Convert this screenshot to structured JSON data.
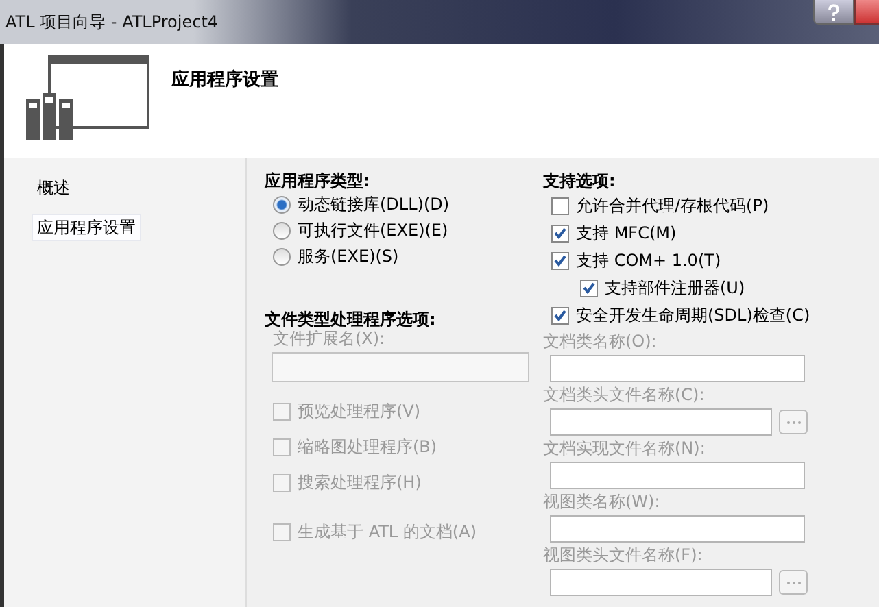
{
  "window": {
    "title": "ATL 项目向导 - ATLProject4"
  },
  "header": {
    "title": "应用程序设置"
  },
  "sidebar": {
    "items": [
      {
        "label": "概述",
        "selected": false
      },
      {
        "label": "应用程序设置",
        "selected": true
      }
    ]
  },
  "app_type": {
    "heading": "应用程序类型:",
    "options": [
      {
        "label": "动态链接库(DLL)(D)",
        "selected": true
      },
      {
        "label": "可执行文件(EXE)(E)",
        "selected": false
      },
      {
        "label": "服务(EXE)(S)",
        "selected": false
      }
    ]
  },
  "file_handlers": {
    "heading": "文件类型处理程序选项:",
    "extension_label": "文件扩展名(X):",
    "extension_disabled": true,
    "options": [
      {
        "label": "预览处理程序(V)",
        "checked": false,
        "disabled": true
      },
      {
        "label": "缩略图处理程序(B)",
        "checked": false,
        "disabled": true
      },
      {
        "label": "搜索处理程序(H)",
        "checked": false,
        "disabled": true
      },
      {
        "label": "生成基于 ATL 的文档(A)",
        "checked": false,
        "disabled": true
      }
    ]
  },
  "support": {
    "heading": "支持选项:",
    "options": [
      {
        "label": "允许合并代理/存根代码(P)",
        "checked": false,
        "disabled": false
      },
      {
        "label": "支持 MFC(M)",
        "checked": true,
        "disabled": false
      },
      {
        "label": "支持 COM+ 1.0(T)",
        "checked": true,
        "disabled": false,
        "children": [
          {
            "label": "支持部件注册器(U)",
            "checked": true,
            "disabled": false
          }
        ]
      },
      {
        "label": "安全开发生命周期(SDL)检查(C)",
        "checked": true,
        "disabled": false
      }
    ]
  },
  "doc_fields": [
    {
      "label": "文档类名称(O):",
      "browse": false,
      "disabled": true
    },
    {
      "label": "文档类头文件名称(C):",
      "browse": true,
      "disabled": true
    },
    {
      "label": "文档实现文件名称(N):",
      "browse": false,
      "disabled": true
    },
    {
      "label": "视图类名称(W):",
      "browse": false,
      "disabled": true
    },
    {
      "label": "视图类头文件名称(F):",
      "browse": true,
      "disabled": true
    }
  ]
}
